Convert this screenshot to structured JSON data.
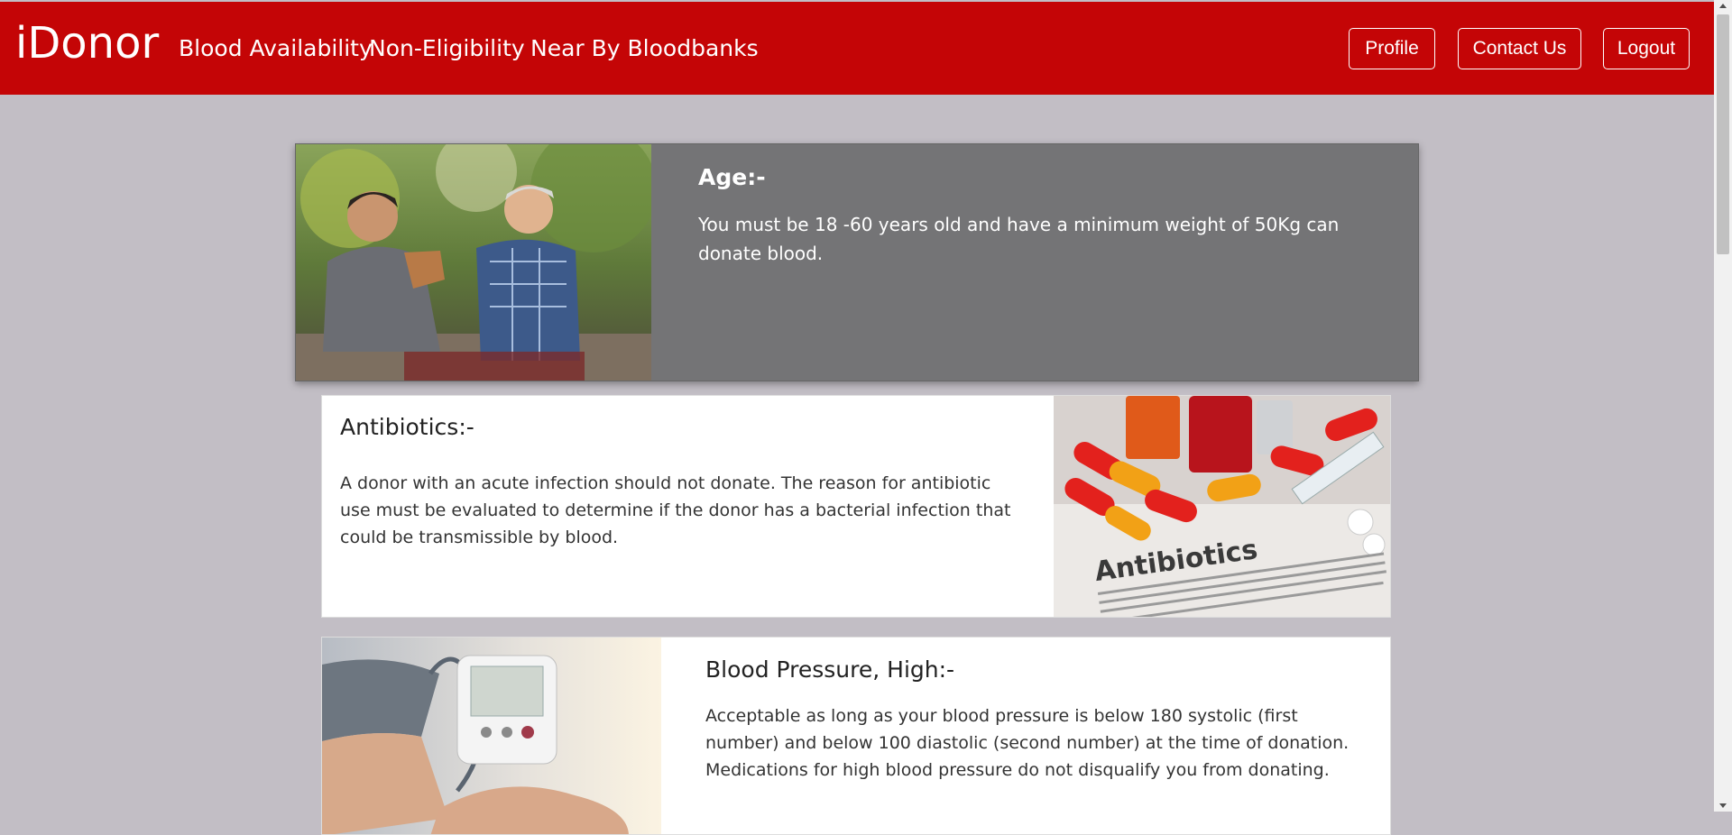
{
  "navbar": {
    "brand": "iDonor",
    "links": [
      "Blood Availability",
      "Non-Eligibility",
      "Near By Bloodbanks"
    ],
    "buttons": [
      "Profile",
      "Contact Us",
      "Logout"
    ]
  },
  "cards": [
    {
      "title": "Age:-",
      "text": "You must be 18 -60 years old and have a minimum weight of 50Kg can donate blood."
    },
    {
      "title": "Antibiotics:-",
      "text": "A donor with an acute infection should not donate. The reason for antibiotic use must be evaluated to determine if the donor has a bacterial infection that could be transmissible by blood.",
      "image_text": "Antibiotics"
    },
    {
      "title": "Blood Pressure, High:-",
      "text": "Acceptable as long as your blood pressure is below 180 systolic (first number) and below 100 diastolic (second number) at the time of donation. Medications for high blood pressure do not disqualify you from donating."
    }
  ],
  "colors": {
    "nav_bg": "#c40506",
    "page_bg": "#c2bec5",
    "age_card_bg": "#747476"
  }
}
